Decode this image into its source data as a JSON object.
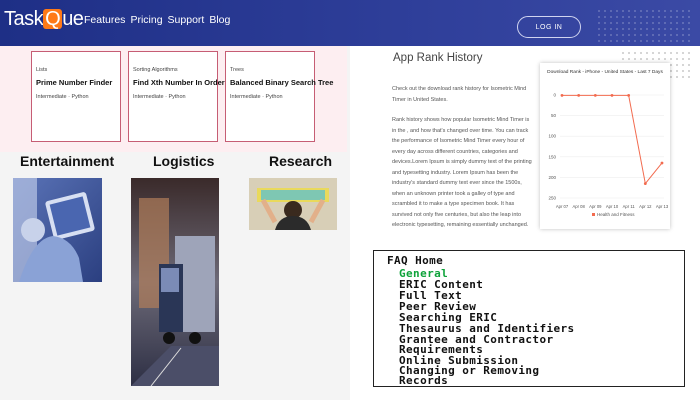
{
  "brand": {
    "logo_pre": "Task",
    "logo_q": "Q",
    "logo_post": "ue"
  },
  "nav": [
    "Features",
    "Pricing",
    "Support",
    "Blog"
  ],
  "login_label": "LOG IN",
  "cards": [
    {
      "tag": "Lists",
      "title": "Prime Number Finder",
      "meta": "Intermediate · Python"
    },
    {
      "tag": "Sorting Algorithms",
      "title": "Find Xth Number In Order",
      "meta": "Intermediate · Python"
    },
    {
      "tag": "Trees",
      "title": "Balanced Binary Search Tree",
      "meta": "Intermediate · Python"
    }
  ],
  "categories": [
    "Entertainment",
    "Logistics",
    "Research"
  ],
  "rank": {
    "title": "App Rank History",
    "intro": "Check out the download rank history for Isometric Mind Timer in United States.",
    "body": "Rank history shows how popular Isometric Mind Timer is in the , and how that's changed over time. You can track the performance of Isometric Mind Timer every hour of every day across different countries, categories and devices.Lorem Ipsum is simply dummy text of the printing and typesetting industry. Lorem Ipsum has been the industry's standard dummy text ever since the 1500s, when an unknown printer took a galley of type and scrambled it to make a type specimen book. It has survived not only five centuries, but also the leap into electronic typesetting, remaining essentially unchanged."
  },
  "chart_data": {
    "type": "line",
    "title": "Download Rank - iPhone - United States - Last 7 Days",
    "categories": [
      "Apr 07",
      "Apr 08",
      "Apr 09",
      "Apr 10",
      "Apr 11",
      "Apr 12",
      "Apr 13"
    ],
    "series": [
      {
        "name": "Health and Fitness",
        "values": [
          1,
          1,
          1,
          1,
          1,
          215,
          165
        ]
      }
    ],
    "yticks": [
      0,
      50,
      100,
      150,
      200,
      250
    ],
    "ylim": [
      0,
      250
    ],
    "y_reversed": true,
    "color": "#f26b4f",
    "legend_position": "bottom"
  },
  "faq": {
    "home": "FAQ Home",
    "items": [
      "General",
      "ERIC Content",
      "Full Text",
      "Peer Review",
      "Searching ERIC",
      "Thesaurus and Identifiers",
      "Grantee and Contractor",
      "Requirements",
      "Online Submission",
      "Changing or Removing",
      "Records"
    ],
    "active_index": 0
  }
}
